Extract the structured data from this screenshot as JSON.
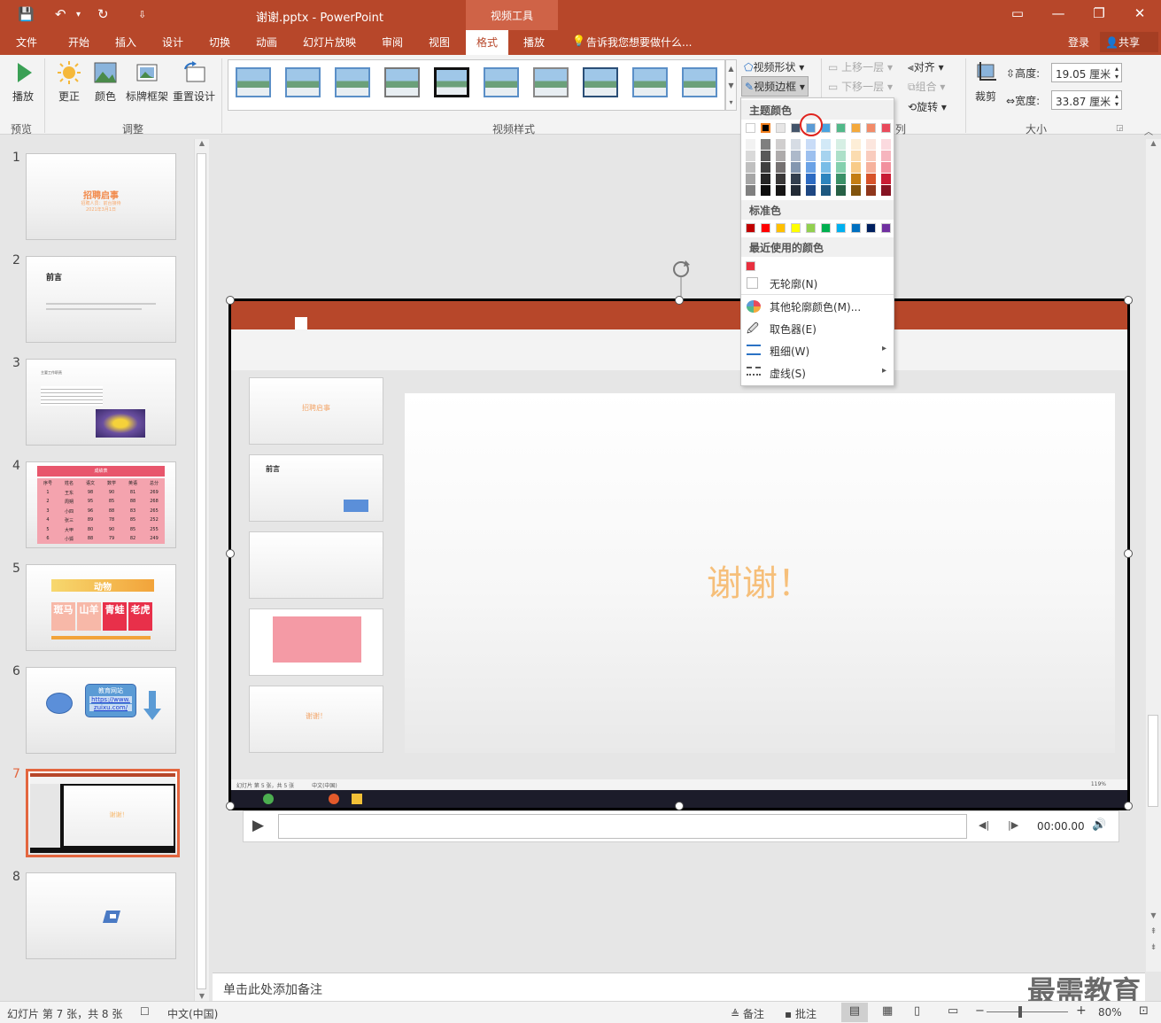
{
  "window": {
    "title": "谢谢.pptx - PowerPoint",
    "context_tab": "视频工具",
    "controls": [
      "▭",
      "—",
      "❐",
      "✕"
    ]
  },
  "quick_access": {
    "save": "💾",
    "undo": "↶",
    "undo_dd": "▾",
    "redo": "↻",
    "customize": "⇩"
  },
  "tabs": [
    "文件",
    "开始",
    "插入",
    "设计",
    "切换",
    "动画",
    "幻灯片放映",
    "审阅",
    "视图",
    "格式",
    "播放"
  ],
  "active_tab": "格式",
  "tell_me": "告诉我您想要做什么...",
  "account": {
    "login": "登录",
    "share": "共享"
  },
  "ribbon": {
    "preview": {
      "play": "播放",
      "group": "预览"
    },
    "adjust": {
      "correct": "更正",
      "color": "颜色",
      "poster": "标牌框架",
      "reset": "重置设计",
      "group": "调整"
    },
    "styles": {
      "group": "视频样式",
      "shape": "视频形状",
      "border": "视频边框",
      "effects": "列"
    },
    "arrange": {
      "forward": "上移一层",
      "backward": "下移一层",
      "align": "对齐",
      "group_btn": "组合",
      "rotate": "旋转"
    },
    "size": {
      "crop": "裁剪",
      "height_label": "高度:",
      "height": "19.05 厘米",
      "width_label": "宽度:",
      "width": "33.87 厘米",
      "group": "大小"
    }
  },
  "border_menu": {
    "theme_header": "主题颜色",
    "standard_header": "标准色",
    "recent_header": "最近使用的颜色",
    "theme_top": [
      "#ffffff",
      "#000000",
      "#e7e6e6",
      "#44546a",
      "#5b9bd5",
      "#4aa3df",
      "#52b98a",
      "#f4a93c",
      "#f28b69",
      "#e94a5c"
    ],
    "theme_cols": [
      [
        "#f2f2f2",
        "#d9d9d9",
        "#bfbfbf",
        "#a6a6a6",
        "#808080"
      ],
      [
        "#7f7f7f",
        "#595959",
        "#404040",
        "#262626",
        "#0d0d0d"
      ],
      [
        "#d0cece",
        "#aeabab",
        "#757171",
        "#3a3838",
        "#171616"
      ],
      [
        "#d6dce4",
        "#adb9ca",
        "#8497b0",
        "#333f4f",
        "#222a35"
      ],
      [
        "#c9dcf7",
        "#9cc0ef",
        "#6aa2e6",
        "#2d6bc2",
        "#1e4782"
      ],
      [
        "#d2e9f7",
        "#a6d3ef",
        "#79bde7",
        "#2c85be",
        "#1d5880"
      ],
      [
        "#d6efe4",
        "#ade0c9",
        "#84d0ae",
        "#3a9168",
        "#276146"
      ],
      [
        "#fdeed7",
        "#fbdcb0",
        "#f8cb88",
        "#c47e14",
        "#82540d"
      ],
      [
        "#fce6de",
        "#f9ccbe",
        "#f6b29d",
        "#d7532a",
        "#8f371c"
      ],
      [
        "#fbdadf",
        "#f6b5be",
        "#f2919e",
        "#c91c34",
        "#861323"
      ]
    ],
    "standard": [
      "#c00000",
      "#ff0000",
      "#ffc000",
      "#ffff00",
      "#92d050",
      "#00b050",
      "#00b0f0",
      "#0070c0",
      "#002060",
      "#7030a0"
    ],
    "recent": [
      "#e8303f"
    ],
    "items": [
      {
        "label": "无轮廓(N)",
        "arrow": false
      },
      {
        "label": "其他轮廓颜色(M)...",
        "arrow": false
      },
      {
        "label": "取色器(E)",
        "arrow": false
      },
      {
        "label": "粗细(W)",
        "arrow": true
      },
      {
        "label": "虚线(S)",
        "arrow": true
      }
    ],
    "submenu_arrow": "▸"
  },
  "slides": [
    {
      "num": "1",
      "title": "招聘启事",
      "sub1": "招聘人员：前台接待",
      "sub2": "2021年3月1日"
    },
    {
      "num": "2",
      "title": "前言"
    },
    {
      "num": "3",
      "title": "主要工作职责"
    },
    {
      "num": "4",
      "title": "成绩表",
      "rows": [
        [
          "序号",
          "姓名",
          "语文",
          "数学",
          "英语",
          "总分"
        ],
        [
          "1",
          "王东",
          "98",
          "90",
          "81",
          "269"
        ],
        [
          "2",
          "周朔",
          "95",
          "85",
          "88",
          "268"
        ],
        [
          "3",
          "小四",
          "96",
          "88",
          "83",
          "265"
        ],
        [
          "4",
          "张三",
          "89",
          "78",
          "85",
          "252"
        ],
        [
          "5",
          "大甲",
          "80",
          "90",
          "85",
          "255"
        ],
        [
          "6",
          "小狐",
          "88",
          "79",
          "82",
          "249"
        ]
      ]
    },
    {
      "num": "5",
      "title": "动物",
      "cells": [
        "斑马",
        "山羊",
        "青蛙",
        "老虎"
      ]
    },
    {
      "num": "6",
      "box": "教育网站",
      "link1": "https://www.",
      "link2": "zuixu.com/"
    },
    {
      "num": "7",
      "title": "谢谢！"
    },
    {
      "num": "8"
    }
  ],
  "video": {
    "big_text": "谢谢！",
    "time": "00:00.00",
    "inner_status": "幻灯片 第 5 张，共 5 张",
    "inner_lang": "中文(中国)",
    "inner_zoom": "119%"
  },
  "notes": "单击此处添加备注",
  "status": {
    "slide": "幻灯片 第 7 张，共 8 张",
    "lang": "中文(中国)",
    "notes": "备注",
    "comments": "批注",
    "zoom": "80%",
    "minus": "−",
    "plus": "+"
  },
  "watermark": "最需教育"
}
